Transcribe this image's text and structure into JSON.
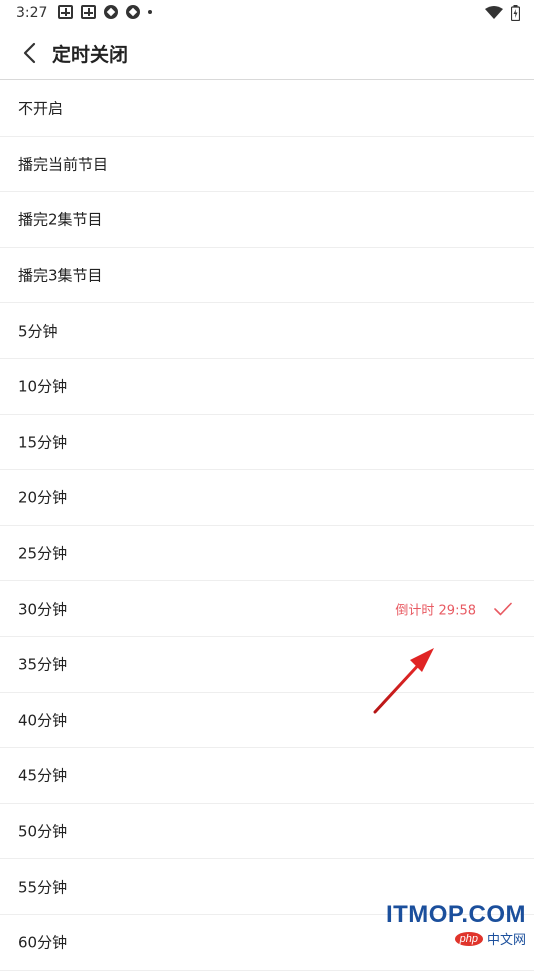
{
  "status_bar": {
    "time": "3:27"
  },
  "header": {
    "title": "定时关闭",
    "back_icon": "chevron-left-icon"
  },
  "options": [
    {
      "label": "不开启"
    },
    {
      "label": "播完当前节目"
    },
    {
      "label": "播完2集节目"
    },
    {
      "label": "播完3集节目"
    },
    {
      "label": "5分钟"
    },
    {
      "label": "10分钟"
    },
    {
      "label": "15分钟"
    },
    {
      "label": "20分钟"
    },
    {
      "label": "25分钟"
    },
    {
      "label": "30分钟",
      "selected": true,
      "countdown": "倒计时 29:58"
    },
    {
      "label": "35分钟"
    },
    {
      "label": "40分钟"
    },
    {
      "label": "45分钟"
    },
    {
      "label": "50分钟"
    },
    {
      "label": "55分钟"
    },
    {
      "label": "60分钟"
    }
  ],
  "colors": {
    "accent": "#e85a62",
    "annotation_arrow": "#d42020",
    "watermark": "#1b4f9c"
  },
  "watermark": {
    "main": "ITMOP.COM",
    "badge": "php",
    "sub": "中文网"
  }
}
